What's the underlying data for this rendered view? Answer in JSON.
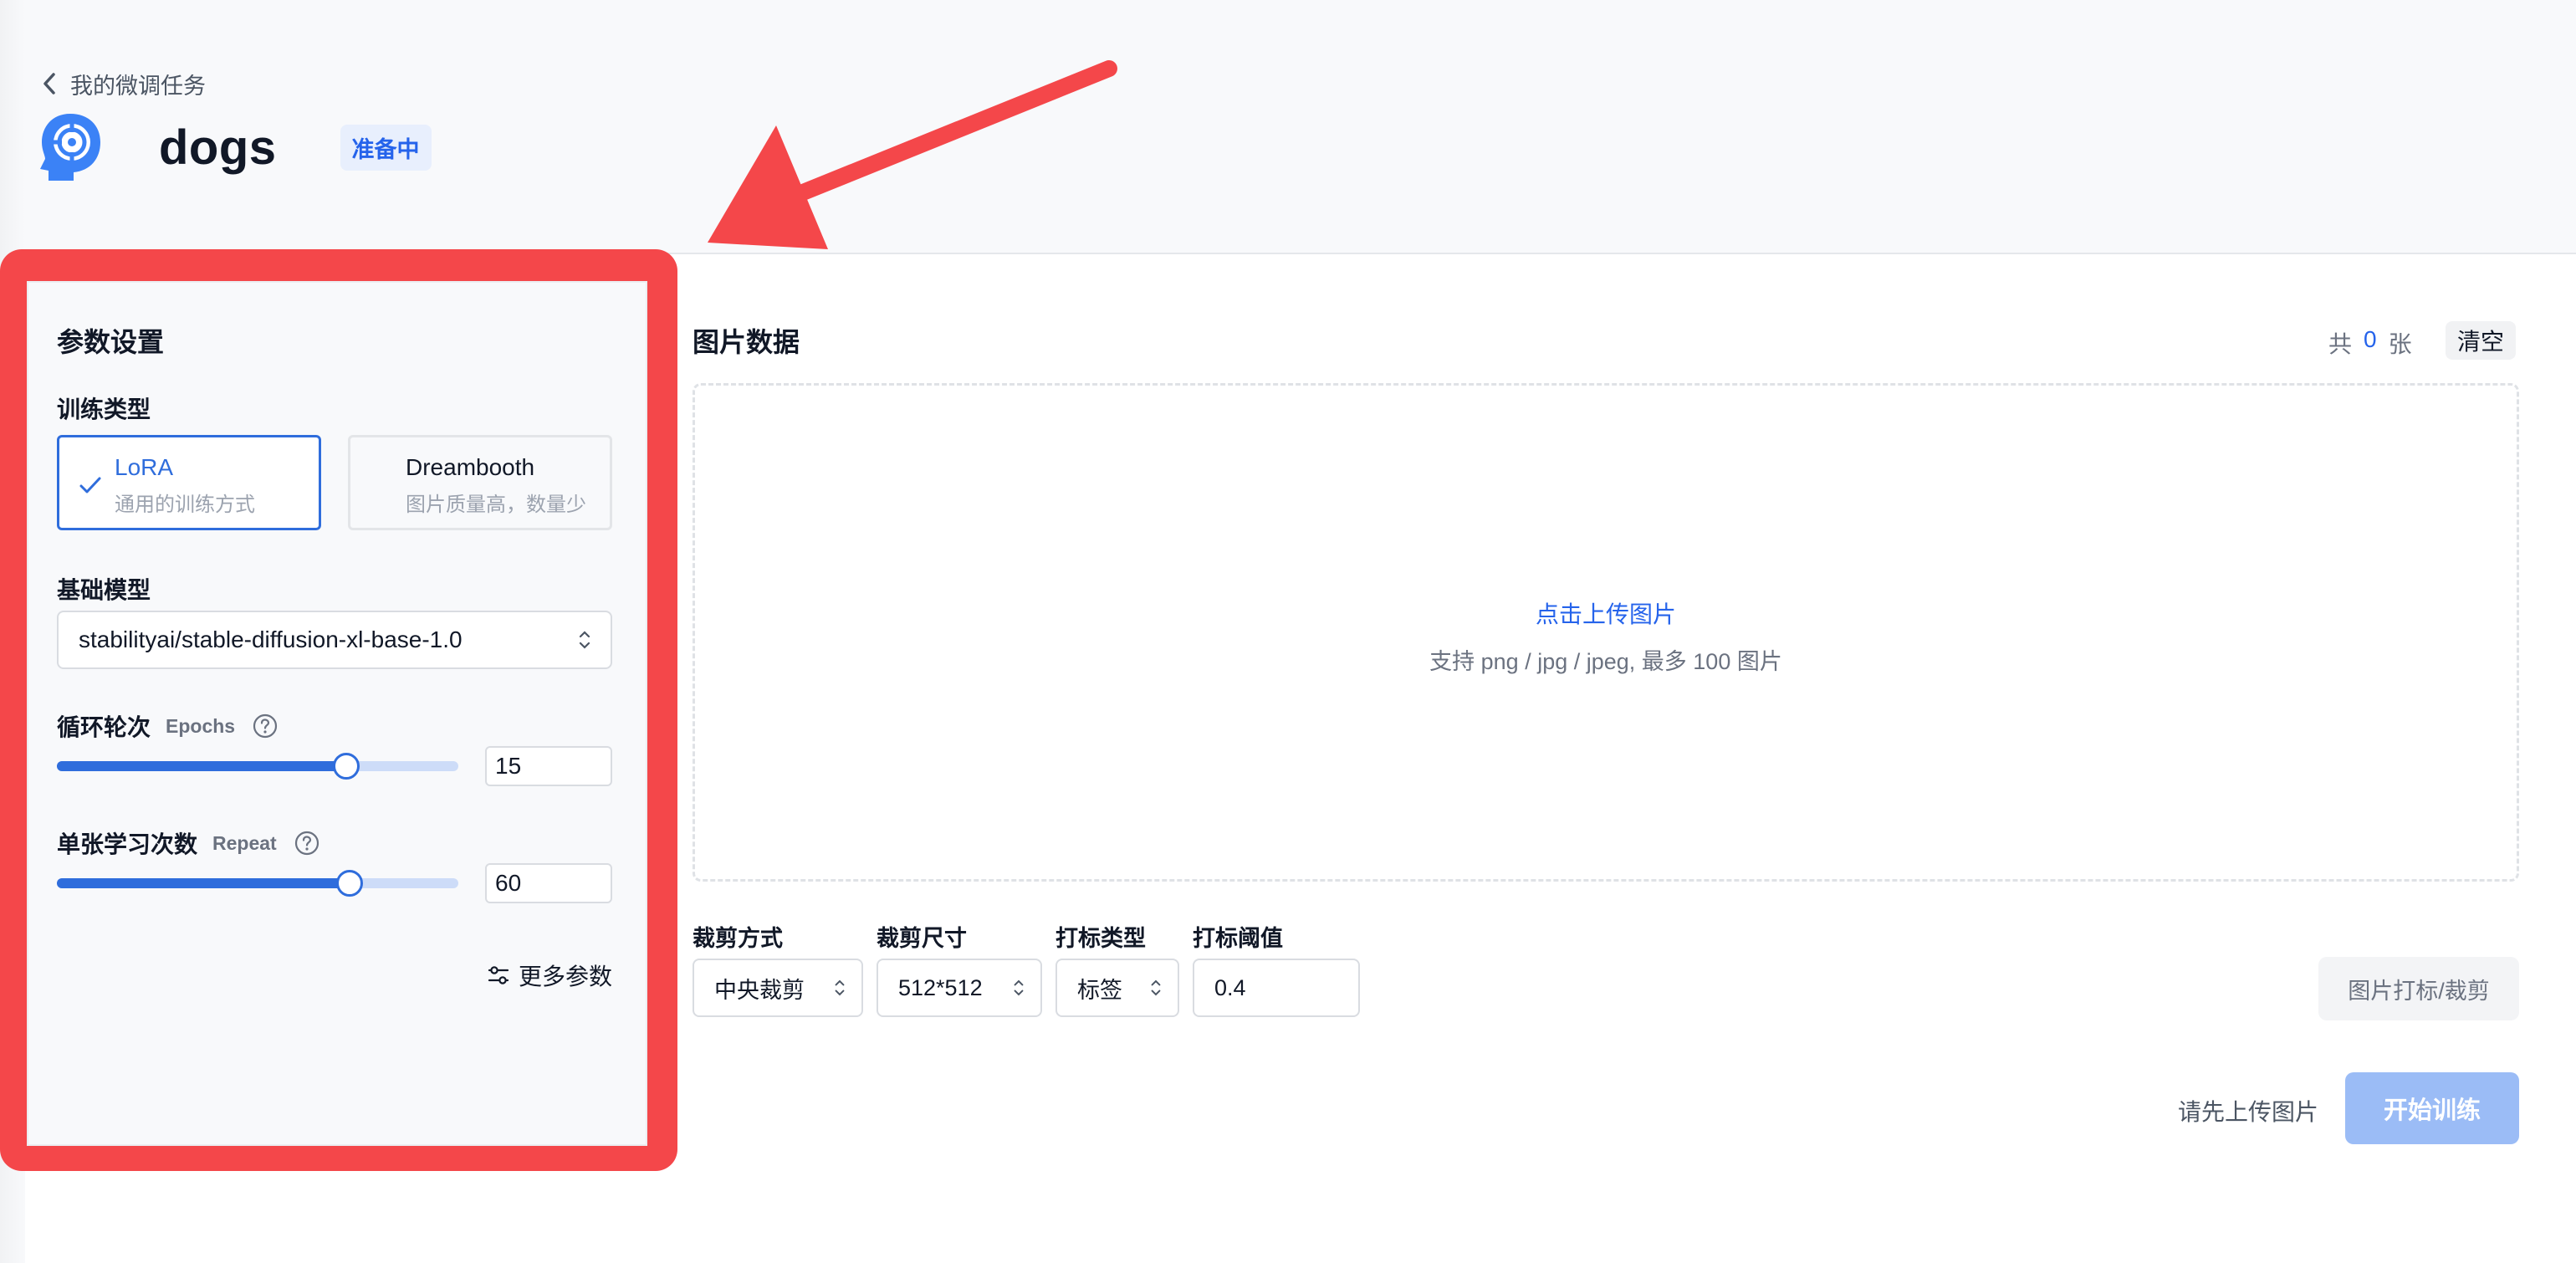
{
  "header": {
    "breadcrumb": "我的微调任务",
    "title": "dogs",
    "status": "准备中"
  },
  "params": {
    "title": "参数设置",
    "training_type_label": "训练类型",
    "types": [
      {
        "name": "LoRA",
        "desc": "通用的训练方式",
        "selected": true
      },
      {
        "name": "Dreambooth",
        "desc": "图片质量高，数量少",
        "selected": false
      }
    ],
    "base_model_label": "基础模型",
    "base_model": "stabilityai/stable-diffusion-xl-base-1.0",
    "epochs": {
      "label": "循环轮次",
      "sub": "Epochs",
      "value": "15",
      "slider_fraction": 0.72
    },
    "repeat": {
      "label": "单张学习次数",
      "sub": "Repeat",
      "value": "60",
      "slider_fraction": 0.73
    },
    "more_params": "更多参数"
  },
  "images": {
    "title": "图片数据",
    "count_prefix": "共",
    "count": "0",
    "count_suffix": "张",
    "clear": "清空",
    "upload_link": "点击上传图片",
    "upload_hint": "支持 png / jpg / jpeg, 最多 100 图片"
  },
  "options": {
    "crop_mode": {
      "label": "裁剪方式",
      "value": "中央裁剪"
    },
    "crop_size": {
      "label": "裁剪尺寸",
      "value": "512*512"
    },
    "tag_type": {
      "label": "打标类型",
      "value": "标签"
    },
    "tag_threshold": {
      "label": "打标阈值",
      "value": "0.4"
    },
    "tag_crop_button": "图片打标/裁剪"
  },
  "footer": {
    "hint": "请先上传图片",
    "start_button": "开始训练"
  },
  "colors": {
    "accent": "#2f6ddc",
    "highlight_frame": "#f4474a",
    "arrow": "#f4474a"
  }
}
